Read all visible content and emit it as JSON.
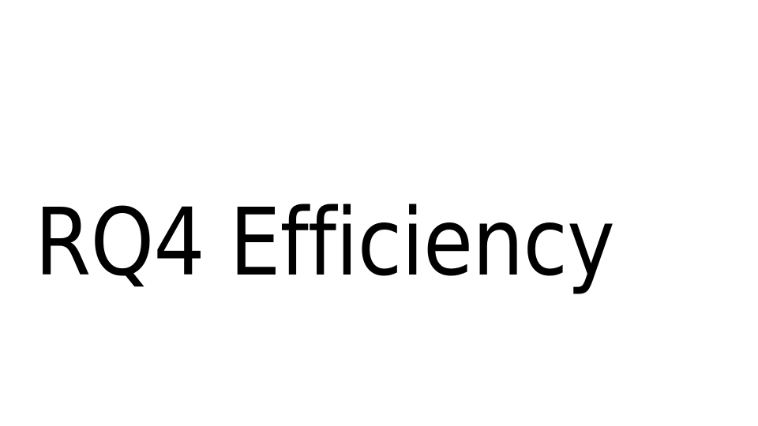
{
  "slide": {
    "title": "RQ4 Efficiency"
  }
}
